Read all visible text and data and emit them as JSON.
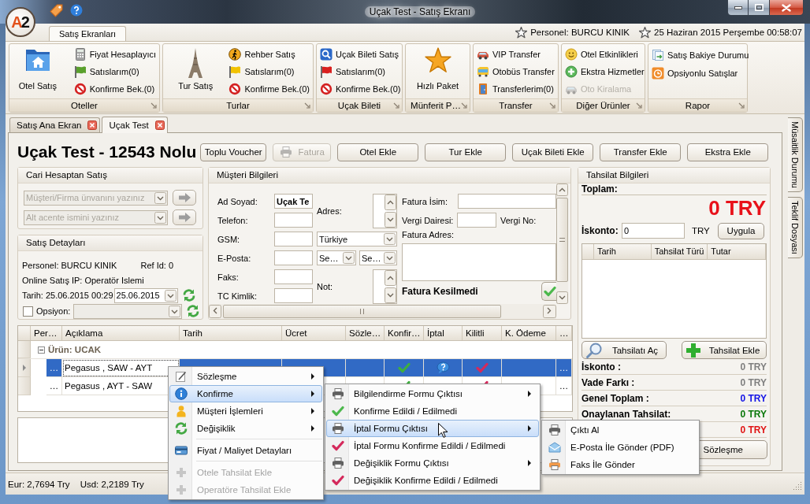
{
  "window": {
    "title": "Uçak Test - Satış Ekranı",
    "logo": [
      {
        "text": "A",
        "color": "#e2521d"
      },
      {
        "text": "2",
        "color": "#111111"
      }
    ]
  },
  "ribbon": {
    "tabs": [
      {
        "label": "Satış Ekranları",
        "selected": true
      }
    ],
    "info": [
      "Personel: BURCU KINIK",
      "25 Haziran 2015 Perşembe 00:58:07"
    ],
    "groups": [
      {
        "label": "Oteller",
        "large": "Otel Satış",
        "items": [
          {
            "label": "Fiyat Hesaplayıcı",
            "disabled": false
          },
          {
            "label": "Satıslarım(0)",
            "disabled": false
          },
          {
            "label": "Konfirme Bek.(0)",
            "disabled": false
          }
        ]
      },
      {
        "label": "Turlar",
        "large": "Tur Satış",
        "items": [
          {
            "label": "Rehber Satış",
            "disabled": false
          },
          {
            "label": "Satıslarım(0)",
            "disabled": false
          },
          {
            "label": "Konfirme Bek.(0)",
            "disabled": false
          }
        ]
      },
      {
        "label": "Uçak Bileti",
        "items": [
          {
            "label": "Uçak Bileti Satış",
            "disabled": false
          },
          {
            "label": "Satıslarım(0)",
            "disabled": false
          },
          {
            "label": "Konfirme Bek.(0)",
            "disabled": false
          }
        ]
      },
      {
        "label": "Münferit P…",
        "large": "Hızlı Paket"
      },
      {
        "label": "Transfer",
        "items": [
          {
            "label": "VIP Transfer",
            "disabled": false
          },
          {
            "label": "Otobüs Transfer",
            "disabled": false
          },
          {
            "label": "Transferlerim(0)",
            "disabled": false
          }
        ]
      },
      {
        "label": "Diğer Ürünler",
        "items": [
          {
            "label": "Otel Etkinlikleri",
            "disabled": false
          },
          {
            "label": "Ekstra Hizmetler",
            "disabled": false
          },
          {
            "label": "Oto Kiralama",
            "disabled": true
          }
        ]
      },
      {
        "label": "Rapor",
        "items": [
          {
            "label": "Satış Bakiye Durumu",
            "disabled": false
          },
          {
            "label": "Opsiyonlu Satışlar",
            "disabled": false
          }
        ]
      }
    ]
  },
  "document_tabs": [
    {
      "label": "Satış Ana Ekran",
      "selected": false
    },
    {
      "label": "Uçak Test",
      "selected": true
    }
  ],
  "side_tabs": [
    "Müsaitlik Durumu",
    "Teklif Dosyası"
  ],
  "page": {
    "heading": "Uçak Test - 12543 Nolu",
    "buttons": [
      {
        "label": "Toplu Voucher",
        "disabled": false
      },
      {
        "label": "Fatura",
        "disabled": true
      },
      {
        "label": "Otel Ekle",
        "disabled": false
      },
      {
        "label": "Tur Ekle",
        "disabled": false
      },
      {
        "label": "Uçak Bileti Ekle",
        "disabled": false
      },
      {
        "label": "Transfer Ekle",
        "disabled": false
      },
      {
        "label": "Ekstra Ekle",
        "disabled": false
      }
    ]
  },
  "cari": {
    "title": "Cari Hesaptan Satış",
    "fields": [
      {
        "placeholder": "Müşteri/Firma ünvanını yazınız",
        "disabled": true
      },
      {
        "placeholder": "Alt acente ismini yazınız",
        "disabled": true
      }
    ]
  },
  "satis_detaylari": {
    "title": "Satış Detayları",
    "personel_label": "Personel:",
    "personel": "BURCU KINIK",
    "ref_id": "Ref Id: 0",
    "ip_label": "Online Satış IP:",
    "ip": "Operatör Islemi",
    "tarih_label": "Tarih:",
    "tarih": "25.06.2015 00:29",
    "date_field": "25.06.2015",
    "opsiyon": {
      "label": "Opsiyon:",
      "checked": false,
      "field_disabled": true
    }
  },
  "musteri": {
    "title": "Müşteri Bilgileri",
    "fields": [
      {
        "label": "Ad Soyad:",
        "value": "Uçak Te"
      },
      {
        "label": "Telefon:"
      },
      {
        "label": "GSM:"
      },
      {
        "label": "E-Posta:"
      },
      {
        "label": "Faks:"
      },
      {
        "label": "TC Kimlik:"
      }
    ],
    "address_label": "Adres:",
    "country": "Türkiye",
    "mail_selects": [
      "Se…",
      "Se…"
    ],
    "note_label": "Not:",
    "invoice_name_label": "Fatura İsim:",
    "tax_office_label": "Vergi Dairesi:",
    "tax_no_label": "Vergi No:",
    "invoice_address_label": "Fatura Adres:",
    "invoice_status": "Fatura Kesilmedi"
  },
  "products": {
    "columns": [
      "Per…",
      "Açıklama",
      "Tarih",
      "Ücret",
      "Sözle…",
      "Konfir…",
      "İptal",
      "Kilitli",
      "K. Ödeme",
      "…"
    ],
    "groups": [
      {
        "label": "Ürün: UCAK",
        "expanded": true,
        "rows": [
          {
            "selected": true,
            "per": "…",
            "description": "Pegasus , SAW - AYT",
            "confirmed": true,
            "cancel_query": true,
            "locked": true,
            "more": "…"
          },
          {
            "selected": false,
            "per": "…",
            "description": "Pegasus , AYT - SAW",
            "confirmed": true,
            "cancel_query": false,
            "locked": true,
            "more": "…"
          }
        ]
      }
    ]
  },
  "tahsilat": {
    "title": "Tahsilat Bilgileri",
    "total_label": "Toplam:",
    "total": "0 TRY",
    "discount_label": "İskonto:",
    "discount": "0",
    "currency": "TRY",
    "apply_button": "Uygula",
    "columns": [
      "Tarih",
      "Tahsilat Türü",
      "Tutar"
    ],
    "buttons": [
      "Tahsilatı Aç",
      "Tahsilat Ekle"
    ],
    "summary": [
      {
        "label": "İskonto :",
        "value": "0 TRY",
        "color": "#808080"
      },
      {
        "label": "Vade Farkı :",
        "value": "0 TRY",
        "color": "#808080"
      },
      {
        "label": "Genel Toplam :",
        "value": "0 TRY",
        "color": "#1414e6"
      },
      {
        "label": "Onaylanan Tahsilat:",
        "value": "0 TRY",
        "color": "#0a780a"
      },
      {
        "value": "0 TRY",
        "color": "#e01414"
      }
    ],
    "contract_button": "Sözleşme"
  },
  "status_bar": [
    "Eur: 2,7694 Try",
    "Usd: 2,2189 Try"
  ],
  "context_menu": {
    "sections": [
      [
        {
          "label": "Sözleşme",
          "submenu": true,
          "selected": false,
          "disabled": false
        },
        {
          "label": "Konfirme",
          "submenu": true,
          "selected": true,
          "disabled": false
        },
        {
          "label": "Müşteri İşlemleri",
          "submenu": true,
          "selected": false,
          "disabled": false
        },
        {
          "label": "Değişiklik",
          "submenu": true,
          "selected": false,
          "disabled": false
        }
      ],
      [
        {
          "label": "Fiyat / Maliyet Detayları",
          "submenu": false,
          "selected": false,
          "disabled": false
        }
      ],
      [
        {
          "label": "Otele Tahsilat Ekle",
          "submenu": false,
          "selected": false,
          "disabled": true
        },
        {
          "label": "Operatöre Tahsilat Ekle",
          "submenu": false,
          "selected": false,
          "disabled": true
        }
      ]
    ]
  },
  "confirm_submenu": {
    "items": [
      {
        "label": "Bilgilendirme Formu Çıktısı",
        "submenu": true,
        "selected": false
      },
      {
        "label": "Konfirme Edildi / Edilmedi",
        "submenu": false,
        "selected": false
      },
      {
        "label": "İptal Formu Çıktısı",
        "submenu": true,
        "selected": true
      },
      {
        "label": "İptal Formu Konfirme Edildi / Edilmedi",
        "submenu": false,
        "selected": false
      },
      {
        "label": "Değişiklik Formu Çıktısı",
        "submenu": true,
        "selected": false
      },
      {
        "label": "Değişiklik Konfirme Edildi / Edilmedi",
        "submenu": false,
        "selected": false
      }
    ]
  },
  "output_submenu": {
    "items": [
      {
        "label": "Çıktı Al",
        "selected": false
      },
      {
        "label": "E-Posta İle Gönder (PDF)",
        "selected": false
      },
      {
        "label": "Faks İle Gönder",
        "selected": false
      }
    ]
  }
}
